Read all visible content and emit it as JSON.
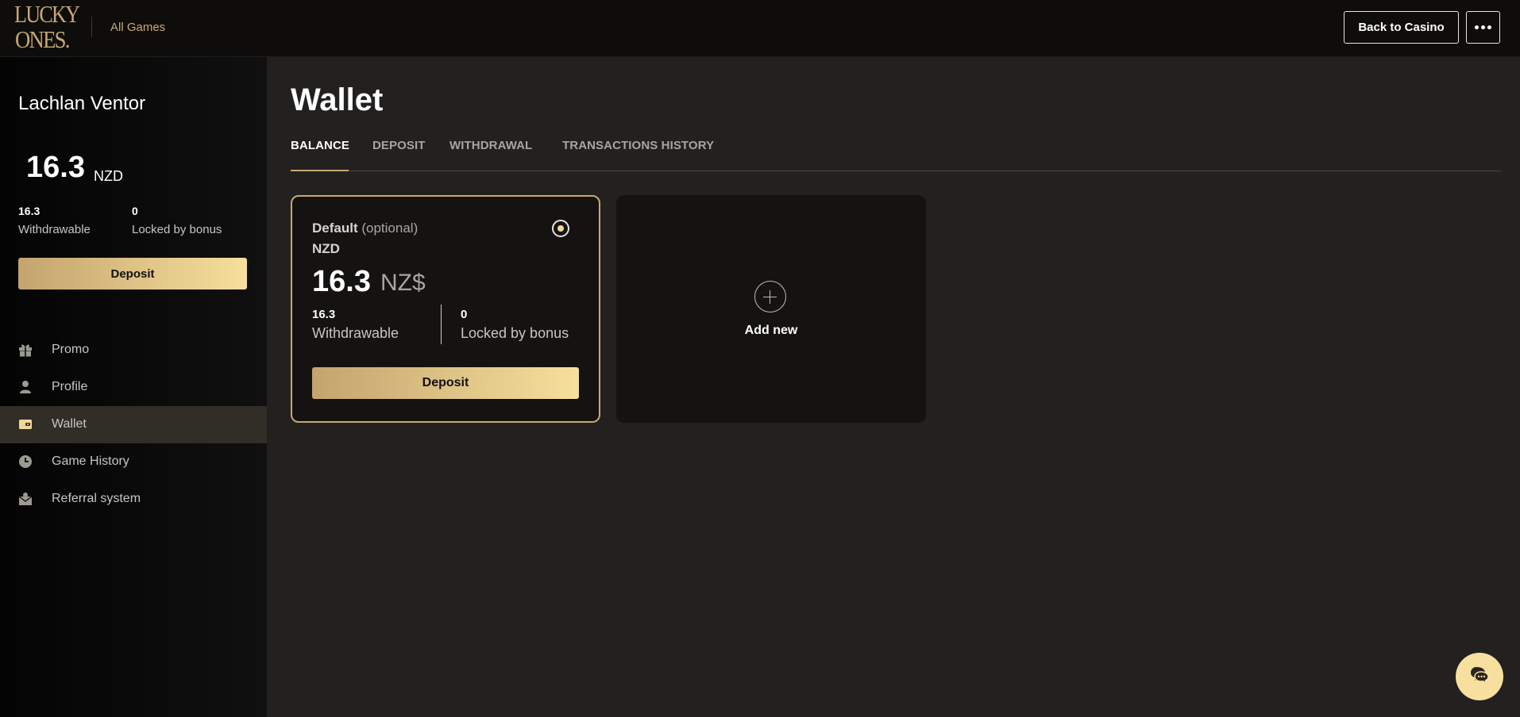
{
  "header": {
    "logo_line1": "LUCKY",
    "logo_line2": "ONES.",
    "all_games": "All Games",
    "back_to_casino": "Back to Casino",
    "more_icon": "more-horizontal-icon"
  },
  "sidebar": {
    "user_name": "Lachlan Ventor",
    "balance": "16.3",
    "currency": "NZD",
    "withdrawable_value": "16.3",
    "withdrawable_label": "Withdrawable",
    "locked_value": "0",
    "locked_label": "Locked by bonus",
    "deposit_label": "Deposit",
    "nav": [
      {
        "label": "Promo",
        "icon": "gift-icon"
      },
      {
        "label": "Profile",
        "icon": "user-icon"
      },
      {
        "label": "Wallet",
        "icon": "wallet-icon",
        "active": true
      },
      {
        "label": "Game History",
        "icon": "clock-icon"
      },
      {
        "label": "Referral system",
        "icon": "referral-icon"
      }
    ]
  },
  "main": {
    "title": "Wallet",
    "tabs": [
      {
        "label": "BALANCE",
        "active": true
      },
      {
        "label": "DEPOSIT"
      },
      {
        "label": "WITHDRAWAL"
      },
      {
        "label": "TRANSACTIONS HISTORY"
      }
    ],
    "wallet_card": {
      "default_label": "Default",
      "optional_label": "(optional)",
      "currency": "NZD",
      "balance": "16.3",
      "symbol": "NZ$",
      "withdrawable_value": "16.3",
      "withdrawable_label": "Withdrawable",
      "locked_value": "0",
      "locked_label": "Locked by bonus",
      "deposit_label": "Deposit",
      "selected": true
    },
    "add_card": {
      "label": "Add new"
    }
  },
  "chat": {
    "icon": "chat-bubble-icon"
  },
  "colors": {
    "accent": "#c9a873",
    "gold_light": "#f7df9c",
    "background": "#22211f",
    "header_bg": "#0e0d0b",
    "card_bg": "#141311"
  }
}
